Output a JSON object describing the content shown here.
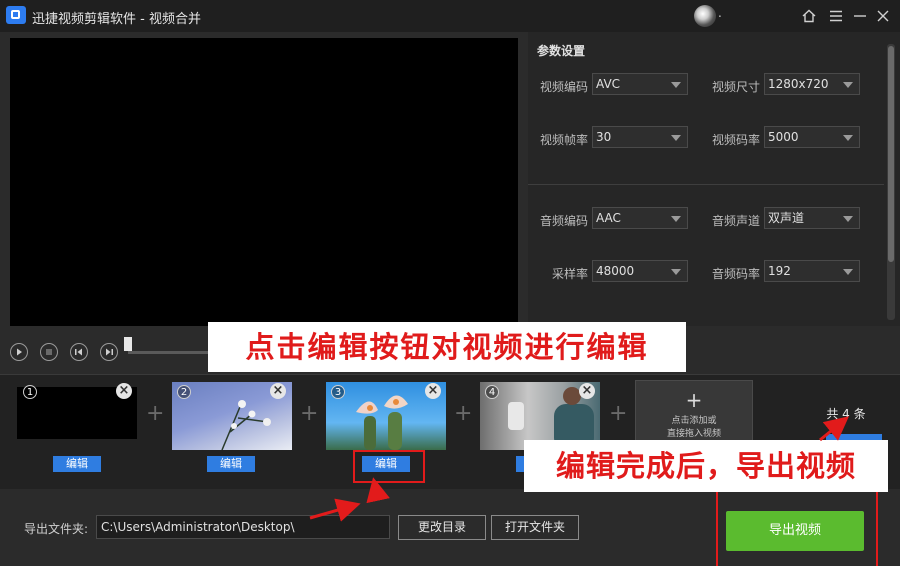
{
  "titlebar": {
    "title": "迅捷视频剪辑软件 - 视频合并",
    "user_suffix": ".",
    "icons": [
      "home-icon",
      "menu-icon",
      "minimize-icon",
      "close-icon"
    ]
  },
  "settings": {
    "title": "参数设置",
    "fields": [
      {
        "label": "视频编码",
        "value": "AVC"
      },
      {
        "label": "视频尺寸",
        "value": "1280x720"
      },
      {
        "label": "视频帧率",
        "value": "30"
      },
      {
        "label": "视频码率",
        "value": "5000"
      },
      {
        "label": "音频编码",
        "value": "AAC"
      },
      {
        "label": "音频声道",
        "value": "双声道"
      },
      {
        "label": "采样率",
        "value": "48000"
      },
      {
        "label": "音频码率",
        "value": "192"
      }
    ]
  },
  "player": {
    "controls": [
      "play-icon",
      "stop-icon",
      "rewind-icon",
      "forward-icon"
    ],
    "progress": 0
  },
  "annotations": {
    "edit_hint": "点击编辑按钮对视频进行编辑",
    "export_hint": "编辑完成后，导出视频"
  },
  "clips": [
    {
      "number": "1",
      "edit_label": "编辑"
    },
    {
      "number": "2",
      "edit_label": "编辑"
    },
    {
      "number": "3",
      "edit_label": "编辑"
    },
    {
      "number": "4",
      "edit_label": "编辑"
    }
  ],
  "add_clip": {
    "symbol": "+",
    "line1": "点击添加或",
    "line2": "直接拖入视频"
  },
  "count": "共 4 条",
  "export": {
    "folder_label": "导出文件夹:",
    "path": "C:\\Users\\Administrator\\Desktop\\",
    "change_dir": "更改目录",
    "open_folder": "打开文件夹",
    "export_button": "导出视频"
  },
  "colors": {
    "accent_blue": "#2f7de1",
    "export_green": "#5bbb2f",
    "annotation_red": "#e01b1b"
  }
}
